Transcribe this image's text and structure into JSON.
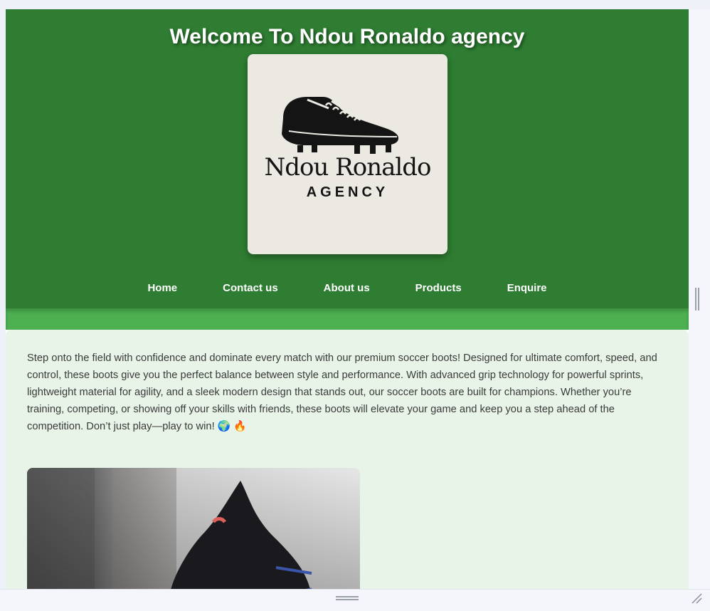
{
  "header": {
    "title": "Welcome To Ndou Ronaldo agency",
    "logo": {
      "name": "Ndou Ronaldo",
      "tagline": "AGENCY",
      "icon": "soccer-boot-icon"
    }
  },
  "nav": {
    "items": [
      {
        "label": "Home"
      },
      {
        "label": "Contact us"
      },
      {
        "label": "About us"
      },
      {
        "label": "Products"
      },
      {
        "label": "Enquire"
      }
    ]
  },
  "main": {
    "intro": "Step onto the field with confidence and dominate every match with our premium soccer boots! Designed for ultimate comfort, speed, and control, these boots give you the perfect balance between style and performance. With advanced grip technology for powerful sprints, lightweight material for agility, and a sleek modern design that stands out, our soccer boots are built for champions. Whether you’re training, competing, or showing off your skills with friends, these boots will elevate your game and keep you a step ahead of the competition. Don’t just play—play to win! 🌍 🔥",
    "product_image": {
      "subject": "black soccer boot",
      "icon": "product-photo"
    }
  },
  "colors": {
    "header_bg": "#2e7d32",
    "band": "#4caf50",
    "content_bg": "#e9f4e9",
    "logo_bg": "#ece9e3"
  }
}
